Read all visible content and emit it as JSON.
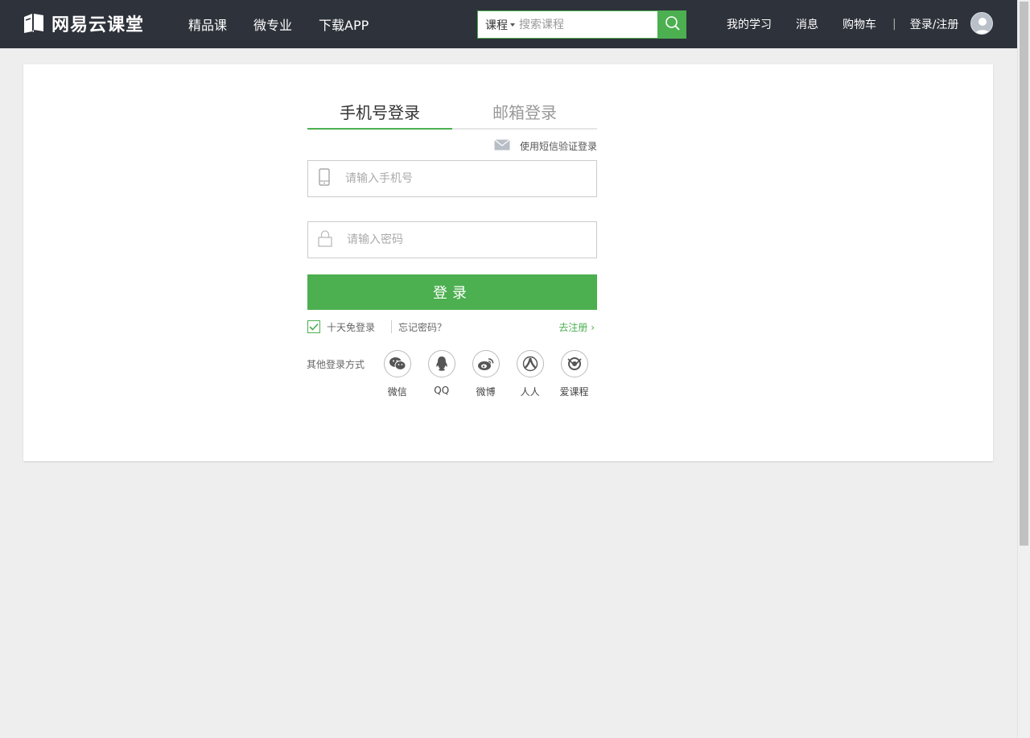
{
  "brand": {
    "name": "网易云课堂"
  },
  "nav": {
    "items": [
      "精品课",
      "微专业",
      "下载APP"
    ]
  },
  "search": {
    "category": "课程",
    "placeholder": "搜索课程"
  },
  "user_nav": {
    "my_learning": "我的学习",
    "messages": "消息",
    "cart": "购物车",
    "separator": "|",
    "login_register": "登录/注册"
  },
  "login": {
    "tabs": [
      {
        "label": "手机号登录",
        "active": true
      },
      {
        "label": "邮箱登录",
        "active": false
      }
    ],
    "sms_link": "使用短信验证登录",
    "phone_placeholder": "请输入手机号",
    "password_placeholder": "请输入密码",
    "submit": "登录",
    "remember": "十天免登录",
    "remember_checked": true,
    "forgot": "忘记密码？",
    "register": "去注册 ›",
    "other_label": "其他登录方式",
    "social": [
      {
        "name": "微信",
        "icon": "wechat-icon"
      },
      {
        "name": "QQ",
        "icon": "qq-icon"
      },
      {
        "name": "微博",
        "icon": "weibo-icon"
      },
      {
        "name": "人人",
        "icon": "renren-icon"
      },
      {
        "name": "爱课程",
        "icon": "icourse-icon"
      }
    ]
  },
  "colors": {
    "topbar": "#2e323a",
    "accent": "#4caf50",
    "background": "#eeeeee"
  }
}
